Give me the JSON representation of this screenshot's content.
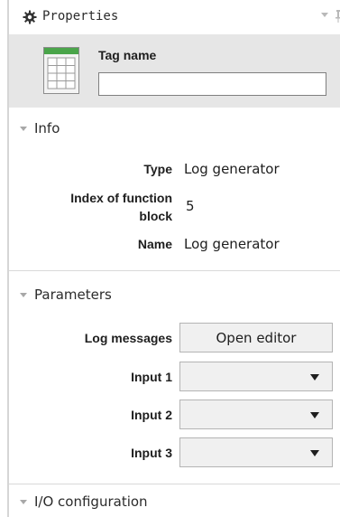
{
  "panel": {
    "title": "Properties",
    "icons": {
      "title": "gear-icon",
      "collapse": "chevron-down-icon",
      "pin": "pin-icon",
      "tag": "table-sheet-icon"
    }
  },
  "tag": {
    "label": "Tag name",
    "value": ""
  },
  "info": {
    "heading": "Info",
    "type_label": "Type",
    "type_value": "Log generator",
    "index_label_line1": "Index of function",
    "index_label_line2": "block",
    "index_value": "5",
    "name_label": "Name",
    "name_value": "Log generator"
  },
  "parameters": {
    "heading": "Parameters",
    "log_messages_label": "Log messages",
    "open_editor_label": "Open editor",
    "input1_label": "Input 1",
    "input1_value": "",
    "input2_label": "Input 2",
    "input2_value": "",
    "input3_label": "Input 3",
    "input3_value": ""
  },
  "io": {
    "heading": "I/O configuration"
  },
  "colors": {
    "header_bg": "#e6e6e6",
    "button_bg": "#f0f0f0",
    "border": "#b4b4b4",
    "triangle": "#a8a8a8",
    "icon_green": "#4aa54a"
  }
}
